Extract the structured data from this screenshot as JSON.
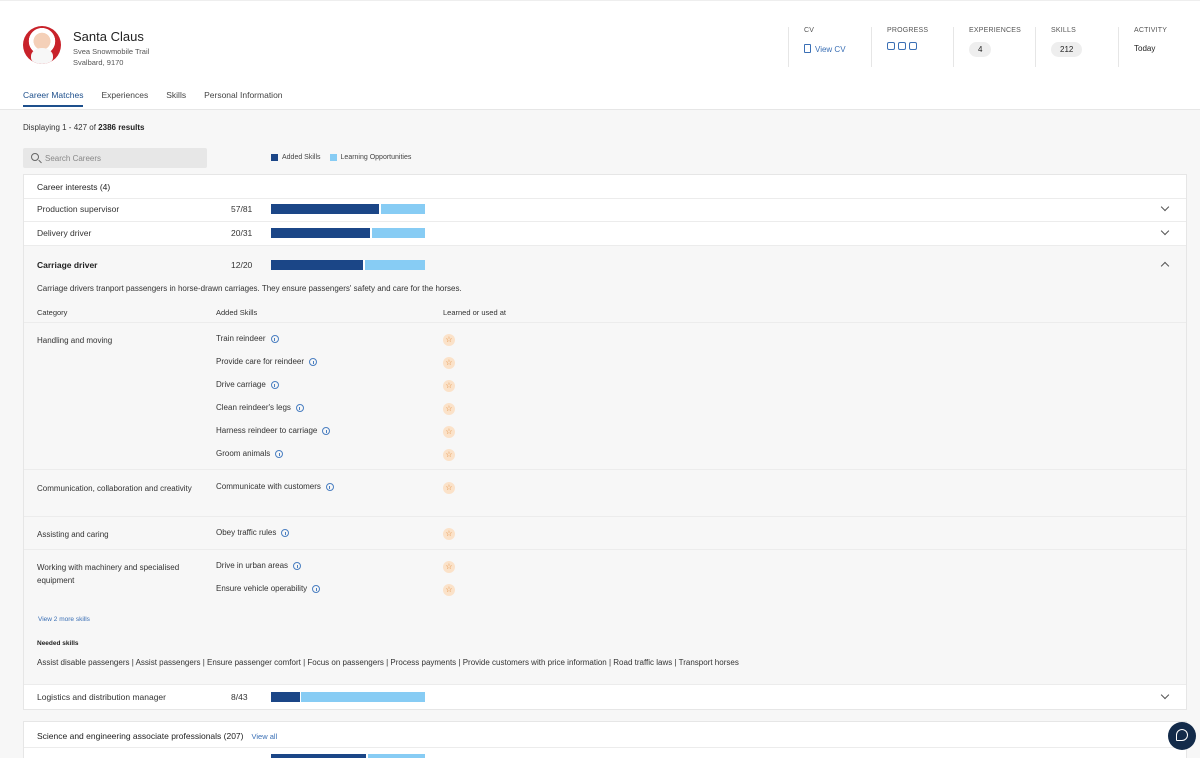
{
  "profile": {
    "name": "Santa Claus",
    "address_line1": "Svea Snowmobile Trail",
    "address_line2": "Svalbard, 9170"
  },
  "stats": [
    {
      "label": "CV",
      "value": "View CV"
    },
    {
      "label": "PROGRESS",
      "value": ""
    },
    {
      "label": "EXPERIENCES",
      "value": "4"
    },
    {
      "label": "SKILLS",
      "value": "212"
    },
    {
      "label": "ACTIVITY",
      "value": "Today"
    }
  ],
  "tabs": [
    "Career Matches",
    "Experiences",
    "Skills",
    "Personal Information"
  ],
  "results": {
    "prefix": "Displaying 1 - 427 of",
    "total": "2386 results"
  },
  "search": {
    "placeholder": "Search Careers"
  },
  "legend": {
    "added": "Added Skills",
    "learning": "Learning Opportunities"
  },
  "colors": {
    "added": "#1b4687",
    "learning": "#87ccf4",
    "accent": "#1d4f8c"
  },
  "career_interests": {
    "title": "Career interests (4)",
    "rows": [
      {
        "name": "Production supervisor",
        "score": "57/81",
        "matched": 57,
        "total": 81
      },
      {
        "name": "Delivery driver",
        "score": "20/31",
        "matched": 20,
        "total": 31
      },
      {
        "name": "Carriage driver",
        "score": "12/20",
        "matched": 12,
        "total": 20
      },
      {
        "name": "Logistics and distribution manager",
        "score": "8/43",
        "matched": 8,
        "total": 43
      }
    ]
  },
  "expanded": {
    "description": "Carriage drivers tranport passengers in horse-drawn carriages. They ensure passengers' safety and care for the horses.",
    "columns": [
      "Category",
      "Added Skills",
      "Learned or used at"
    ],
    "categories": [
      {
        "name": "Handling and moving",
        "skills": [
          "Train reindeer",
          "Provide care for reindeer",
          "Drive carriage",
          "Clean reindeer's legs",
          "Harness reindeer to carriage",
          "Groom animals"
        ]
      },
      {
        "name": "Communication, collaboration and creativity",
        "skills": [
          "Communicate with customers"
        ]
      },
      {
        "name": "Assisting and caring",
        "skills": [
          "Obey traffic rules"
        ]
      },
      {
        "name": "Working with machinery and specialised equipment",
        "skills": [
          "Drive in urban areas",
          "Ensure vehicle operability"
        ]
      }
    ],
    "view_more": "View 2 more skills",
    "needed_label": "Needed skills",
    "needed_skills": "Assist disable passengers | Assist passengers | Ensure passenger comfort | Focus on passengers | Process payments | Provide customers with price information | Road traffic laws | Transport horses"
  },
  "science_group": {
    "title": "Science and engineering associate professionals (207)",
    "view_all": "View all"
  }
}
